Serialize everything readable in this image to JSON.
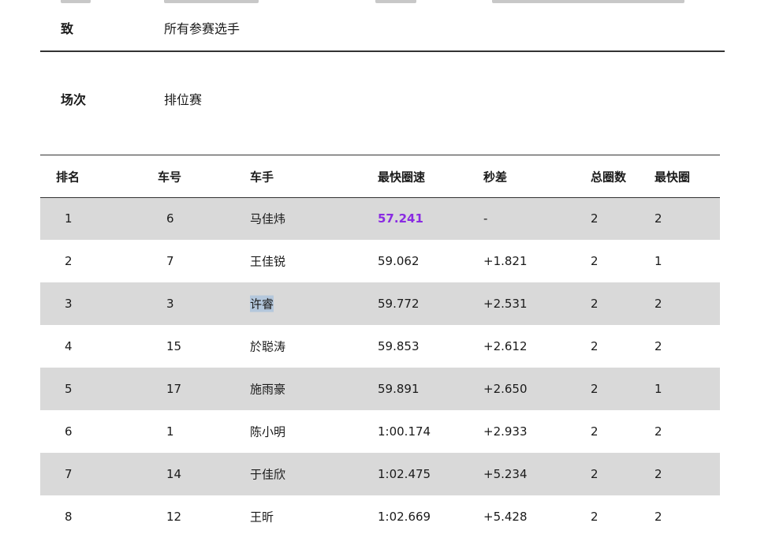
{
  "meta": {
    "row1": {
      "label": "致",
      "value": "所有参赛选手"
    },
    "row2": {
      "label": "场次",
      "value": "排位赛"
    }
  },
  "table": {
    "headers": {
      "rank": "排名",
      "number": "车号",
      "driver": "车手",
      "best_lap": "最快圈速",
      "gap": "秒差",
      "total_laps": "总圈数",
      "best_lap_no": "最快圈"
    },
    "rows": [
      {
        "rank": "1",
        "number": "6",
        "driver": "马佳炜",
        "best_lap": "57.241",
        "gap": "-",
        "total_laps": "2",
        "best_lap_no": "2"
      },
      {
        "rank": "2",
        "number": "7",
        "driver": "王佳锐",
        "best_lap": "59.062",
        "gap": "+1.821",
        "total_laps": "2",
        "best_lap_no": "1"
      },
      {
        "rank": "3",
        "number": "3",
        "driver": "许睿",
        "best_lap": "59.772",
        "gap": "+2.531",
        "total_laps": "2",
        "best_lap_no": "2"
      },
      {
        "rank": "4",
        "number": "15",
        "driver": "於聪涛",
        "best_lap": "59.853",
        "gap": "+2.612",
        "total_laps": "2",
        "best_lap_no": "2"
      },
      {
        "rank": "5",
        "number": "17",
        "driver": "施雨豪",
        "best_lap": "59.891",
        "gap": "+2.650",
        "total_laps": "2",
        "best_lap_no": "1"
      },
      {
        "rank": "6",
        "number": "1",
        "driver": "陈小明",
        "best_lap": "1:00.174",
        "gap": "+2.933",
        "total_laps": "2",
        "best_lap_no": "2"
      },
      {
        "rank": "7",
        "number": "14",
        "driver": "于佳欣",
        "best_lap": "1:02.475",
        "gap": "+5.234",
        "total_laps": "2",
        "best_lap_no": "2"
      },
      {
        "rank": "8",
        "number": "12",
        "driver": "王昕",
        "best_lap": "1:02.669",
        "gap": "+5.428",
        "total_laps": "2",
        "best_lap_no": "2"
      }
    ]
  },
  "colors": {
    "fastest_lap": "#8a2be2",
    "row_shade": "#d9d9d9",
    "text_selection": "#b4c7dc"
  }
}
